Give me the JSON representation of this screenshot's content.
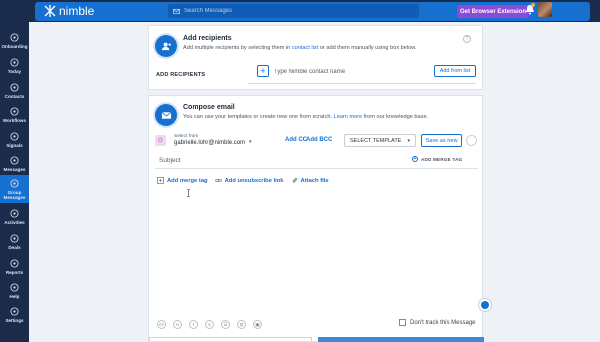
{
  "topbar": {
    "logo_text": "nimble",
    "search_placeholder": "Search Messages",
    "extension_button": "Get Browser Extension",
    "brand_color": "#1670cf",
    "accent_color": "#8a4bd8"
  },
  "sidebar": {
    "items": [
      {
        "label": "Onboarding",
        "icon": "onboarding-icon"
      },
      {
        "label": "Today",
        "icon": "today-icon"
      },
      {
        "label": "Contacts",
        "icon": "contacts-icon"
      },
      {
        "label": "Workflows",
        "icon": "workflows-icon"
      },
      {
        "label": "Signals",
        "icon": "signals-icon"
      },
      {
        "label": "Messages",
        "icon": "messages-icon"
      },
      {
        "label": "Group Messages",
        "icon": "group-messages-icon",
        "active": true
      },
      {
        "label": "Activities",
        "icon": "activities-icon"
      },
      {
        "label": "Deals",
        "icon": "deals-icon"
      },
      {
        "label": "Reports",
        "icon": "reports-icon"
      },
      {
        "label": "Help",
        "icon": "help-icon"
      },
      {
        "label": "Settings",
        "icon": "settings-icon"
      }
    ]
  },
  "recipients": {
    "title": "Add recipients",
    "subtitle_pre": "Add multiple recipients by selecting them in ",
    "subtitle_link": "contact list",
    "subtitle_post": " or add them manually using box below.",
    "section_label": "ADD RECIPIENTS",
    "input_placeholder": "Type Nimble contact name",
    "add_from_list": "Add from list"
  },
  "compose": {
    "title": "Compose email",
    "subtitle_pre": "You can use your templates or create new one from scratch. ",
    "subtitle_link": "Learn more",
    "subtitle_post": " from our knowledge base.",
    "from_badge": "G",
    "from_label": "Select from",
    "from_email": "gabrielle.lohr@nimble.com",
    "add_cc": "Add CC",
    "add_bcc": "Add BCC",
    "template_select": "SELECT TEMPLATE",
    "save_as_new": "Save as new",
    "subject_placeholder": "Subject",
    "add_merge_tag_small": "ADD MERGE TAG",
    "quick_links": {
      "merge_tag": "Add merge tag",
      "unsubscribe": "Add unsubscribe link",
      "attach": "Attach file"
    },
    "toolbar": [
      "<>",
      "A",
      "I",
      "≡",
      "☰",
      "⊡",
      "▣"
    ],
    "dont_track": "Don't track this Message"
  }
}
